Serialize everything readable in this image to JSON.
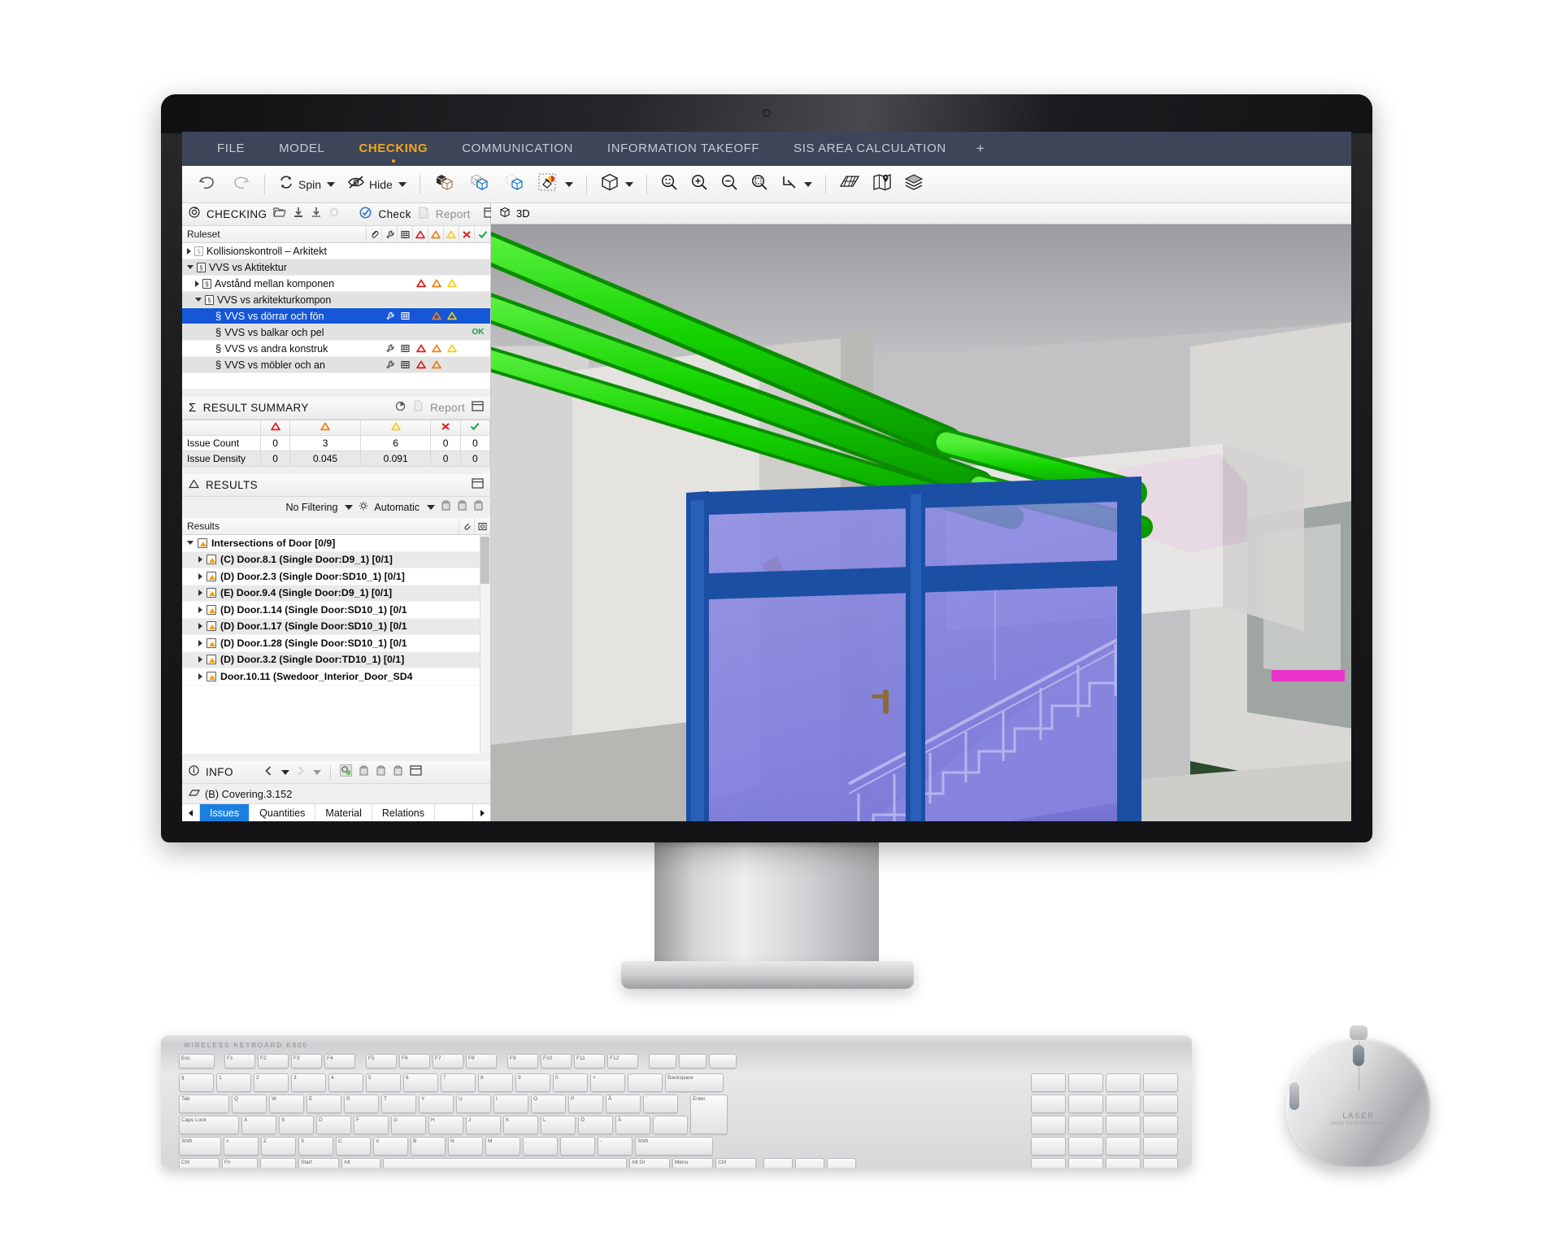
{
  "app": {
    "menu": [
      {
        "label": "FILE",
        "active": false
      },
      {
        "label": "MODEL",
        "active": false
      },
      {
        "label": "CHECKING",
        "active": true
      },
      {
        "label": "COMMUNICATION",
        "active": false
      },
      {
        "label": "INFORMATION TAKEOFF",
        "active": false
      },
      {
        "label": "SIS AREA CALCULATION",
        "active": false
      }
    ],
    "menu_add": "+",
    "accent_color": "#f2a81d",
    "menubar_color": "#3d4559",
    "selection_color": "#1557d6"
  },
  "toolbar": {
    "undo": "undo-icon",
    "redo": "redo-icon",
    "spin_label": "Spin",
    "hide_label": "Hide",
    "items": [
      "show-hide-objects-icon",
      "transparent-objects-icon",
      "ghost-objects-icon",
      "color-objects-icon",
      "view-cube-icon",
      "zoom-fit-icon",
      "zoom-in-icon",
      "zoom-out-icon",
      "zoom-window-icon",
      "clip-plane-icon",
      "grid-icon",
      "map-icon",
      "layers-icon"
    ]
  },
  "checking_pane": {
    "title": "CHECKING",
    "tools": [
      "open-ruleset-icon",
      "import-icon",
      "export-icon",
      "stop-icon"
    ],
    "check_button": "Check",
    "report_button": "Report",
    "dock_icon": "dock-panel-icon",
    "grid_header": {
      "name": "Ruleset",
      "columns": [
        "attachment-icon",
        "wrench-icon",
        "table-icon",
        "severity-red-icon",
        "severity-orange-icon",
        "severity-yellow-icon",
        "fail-icon",
        "pass-icon"
      ]
    },
    "rows": [
      {
        "label": "Kollisionskontroll – Arkitekt",
        "indent": 0,
        "expander": "collapsed",
        "icon": "ruleset-icon-dim",
        "type": "ruleset",
        "wrench": false,
        "table": false,
        "marks": [],
        "alt": false
      },
      {
        "label": "VVS vs Aktitektur",
        "indent": 0,
        "expander": "expanded",
        "icon": "ruleset-icon",
        "type": "ruleset",
        "wrench": false,
        "table": false,
        "marks": [],
        "alt": true
      },
      {
        "label": "Avstånd mellan komponen",
        "indent": 1,
        "expander": "collapsed",
        "icon": "ruleset-icon",
        "type": "ruleset",
        "wrench": false,
        "table": false,
        "marks": [
          "red",
          "orange",
          "yellow"
        ],
        "alt": false
      },
      {
        "label": "VVS vs arkitekturkompon",
        "indent": 1,
        "expander": "expanded",
        "icon": "ruleset-icon",
        "type": "ruleset",
        "wrench": false,
        "table": false,
        "marks": [],
        "alt": true
      },
      {
        "label": "VVS vs dörrar och fön",
        "indent": 2,
        "expander": "none",
        "icon": "section-icon",
        "type": "rule",
        "wrench": true,
        "table": true,
        "marks": [
          "orange",
          "yellow"
        ],
        "alt": false,
        "selected": true
      },
      {
        "label": "VVS vs balkar och pel",
        "indent": 2,
        "expander": "none",
        "icon": "section-icon",
        "type": "rule",
        "wrench": false,
        "table": false,
        "marks": [],
        "ok": "OK",
        "alt": true
      },
      {
        "label": "VVS vs andra konstruk",
        "indent": 2,
        "expander": "none",
        "icon": "section-icon",
        "type": "rule",
        "wrench": true,
        "table": true,
        "marks": [
          "red",
          "orange",
          "yellow"
        ],
        "alt": false
      },
      {
        "label": "VVS vs möbler och an",
        "indent": 2,
        "expander": "none",
        "icon": "section-icon",
        "type": "rule",
        "wrench": true,
        "table": true,
        "marks": [
          "red",
          "orange"
        ],
        "alt": true
      }
    ]
  },
  "result_summary": {
    "title": "RESULT SUMMARY",
    "report_label": "Report",
    "columns": [
      "severity-red-icon",
      "severity-orange-icon",
      "severity-yellow-icon",
      "fail-icon",
      "pass-icon"
    ],
    "rows": [
      {
        "label": "Issue Count",
        "values": [
          "0",
          "3",
          "6",
          "0",
          "0"
        ]
      },
      {
        "label": "Issue Density",
        "values": [
          "0",
          "0.045",
          "0.091",
          "0",
          "0"
        ]
      }
    ]
  },
  "results_pane": {
    "title": "RESULTS",
    "filter_label": "No Filtering",
    "automatic_label": "Automatic",
    "grid_header": "Results",
    "rows": [
      {
        "label": "Intersections of Door [0/9]",
        "indent": 0,
        "expander": "expanded",
        "alt": false
      },
      {
        "label": "(C) Door.8.1 (Single Door:D9_1) [0/1]",
        "indent": 1,
        "expander": "collapsed",
        "alt": true
      },
      {
        "label": "(D) Door.2.3 (Single Door:SD10_1) [0/1]",
        "indent": 1,
        "expander": "collapsed",
        "alt": false
      },
      {
        "label": "(E) Door.9.4 (Single Door:D9_1) [0/1]",
        "indent": 1,
        "expander": "collapsed",
        "alt": true
      },
      {
        "label": "(D) Door.1.14 (Single Door:SD10_1) [0/1",
        "indent": 1,
        "expander": "collapsed",
        "alt": false
      },
      {
        "label": "(D) Door.1.17 (Single Door:SD10_1) [0/1",
        "indent": 1,
        "expander": "collapsed",
        "alt": true
      },
      {
        "label": "(D) Door.1.28 (Single Door:SD10_1) [0/1",
        "indent": 1,
        "expander": "collapsed",
        "alt": false
      },
      {
        "label": "(D) Door.3.2 (Single Door:TD10_1) [0/1]",
        "indent": 1,
        "expander": "collapsed",
        "alt": true
      },
      {
        "label": "Door.10.11 (Swedoor_Interior_Door_SD4",
        "indent": 1,
        "expander": "collapsed",
        "alt": false
      }
    ]
  },
  "info_pane": {
    "title": "INFO",
    "selection": "(B) Covering.3.152",
    "tabs": [
      {
        "label": "Issues",
        "active": true
      },
      {
        "label": "Quantities",
        "active": false
      },
      {
        "label": "Material",
        "active": false
      },
      {
        "label": "Relations",
        "active": false
      }
    ]
  },
  "viewport": {
    "title": "3D"
  }
}
